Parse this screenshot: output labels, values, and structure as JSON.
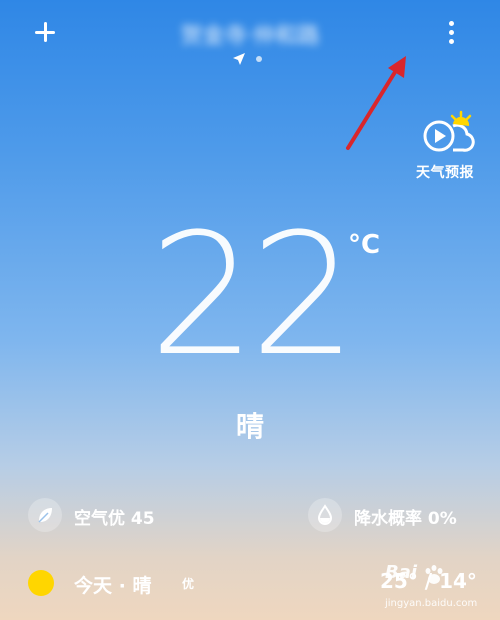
{
  "header": {
    "location": "贺金寺·仲和路",
    "location_obscured": true
  },
  "forecast_video": {
    "label": "天气预报"
  },
  "current": {
    "temperature": "22",
    "unit": "°C",
    "condition": "晴"
  },
  "air_quality": {
    "label": "空气优 45"
  },
  "precipitation": {
    "label": "降水概率 0%"
  },
  "today": {
    "label": "今天 · 晴",
    "badge": "优",
    "range": "25° / 14°"
  },
  "watermark": {
    "logo": "Bai",
    "url": "jingyan.baidu.com"
  },
  "colors": {
    "annotation": "#d9262c",
    "sun": "#ffd600",
    "sky_top": "#2f87e6"
  }
}
